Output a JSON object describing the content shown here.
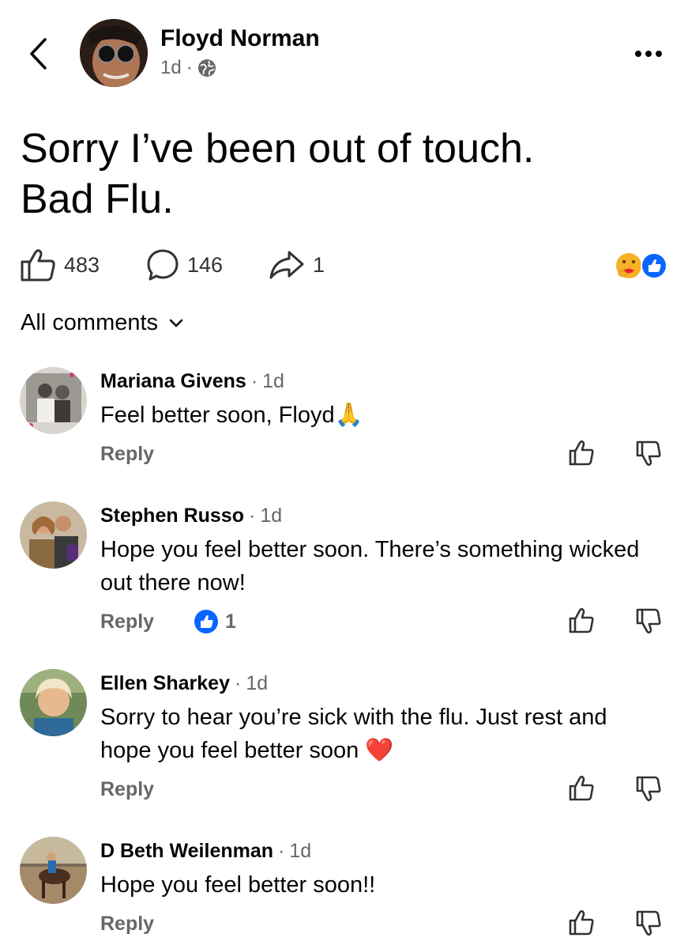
{
  "post": {
    "author": "Floyd Norman",
    "time": "1d",
    "separator": "·",
    "text_line1": "Sorry I’ve been out of touch.",
    "text_line2": "Bad Flu.",
    "likes": "483",
    "comments": "146",
    "shares": "1"
  },
  "comments_header": {
    "label": "All comments"
  },
  "comments": [
    {
      "name": "Mariana Givens",
      "time": "1d",
      "text": "Feel better soon, Floyd",
      "emoji": "🙏",
      "reply": "Reply",
      "likes": ""
    },
    {
      "name": "Stephen Russo",
      "time": "1d",
      "text": "Hope you feel better soon. There’s something wicked out there now!",
      "emoji": "",
      "reply": "Reply",
      "likes": "1"
    },
    {
      "name": "Ellen Sharkey",
      "time": "1d",
      "text": "Sorry to hear you’re sick with the flu. Just rest and hope you feel better soon",
      "emoji": "❤️",
      "reply": "Reply",
      "likes": ""
    },
    {
      "name": "D Beth Weilenman",
      "time": "1d",
      "text": "Hope you feel better soon!!",
      "emoji": "",
      "reply": "Reply",
      "likes": ""
    }
  ],
  "colors": {
    "facebook_blue": "#0866ff",
    "muted_text": "#65676b",
    "primary_text": "#050505",
    "heart_red": "#e8202e",
    "care_yellow": "#f7b125"
  },
  "icons": {
    "back": "chevron-left-icon",
    "privacy": "globe-icon",
    "more": "more-dots-icon",
    "like": "thumbs-up-outline-icon",
    "comment": "speech-bubble-icon",
    "share": "share-arrow-icon",
    "reaction_care": "care-reaction-icon",
    "reaction_like": "like-reaction-icon",
    "dropdown": "chevron-down-icon",
    "comment_like": "thumbs-up-icon",
    "comment_dislike": "thumbs-down-icon"
  }
}
